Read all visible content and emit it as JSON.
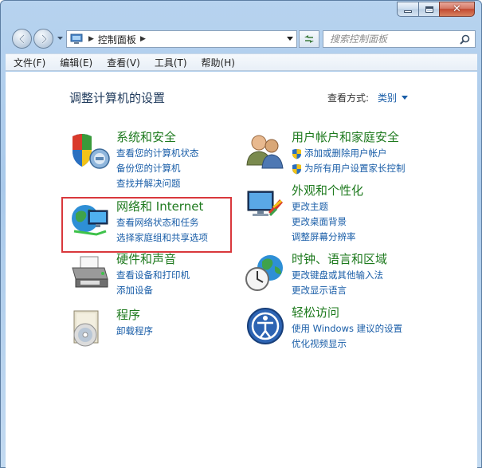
{
  "address": {
    "crumb": "控制面板",
    "search_placeholder": "搜索控制面板"
  },
  "menu": [
    "文件(F)",
    "编辑(E)",
    "查看(V)",
    "工具(T)",
    "帮助(H)"
  ],
  "content": {
    "title": "调整计算机的设置",
    "view_by_label": "查看方式:",
    "view_by_value": "类别"
  },
  "categories": {
    "system_security": {
      "title": "系统和安全",
      "icon": "shield-pc-icon",
      "links": [
        "查看您的计算机状态",
        "备份您的计算机",
        "查找并解决问题"
      ]
    },
    "network": {
      "title": "网络和 Internet",
      "icon": "network-globe-icon",
      "links": [
        "查看网络状态和任务",
        "选择家庭组和共享选项"
      ]
    },
    "hardware_sound": {
      "title": "硬件和声音",
      "icon": "printer-icon",
      "links": [
        "查看设备和打印机",
        "添加设备"
      ]
    },
    "programs": {
      "title": "程序",
      "icon": "programs-disc-icon",
      "links": [
        "卸载程序"
      ]
    },
    "user_accounts": {
      "title": "用户帐户和家庭安全",
      "icon": "users-icon",
      "links": [
        "添加或删除用户帐户",
        "为所有用户设置家长控制"
      ]
    },
    "appearance": {
      "title": "外观和个性化",
      "icon": "monitor-paint-icon",
      "links": [
        "更改主题",
        "更改桌面背景",
        "调整屏幕分辨率"
      ]
    },
    "clock_region": {
      "title": "时钟、语言和区域",
      "icon": "clock-globe-icon",
      "links": [
        "更改键盘或其他输入法",
        "更改显示语言"
      ]
    },
    "ease_access": {
      "title": "轻松访问",
      "icon": "ease-of-access-icon",
      "links": [
        "使用 Windows 建议的设置",
        "优化视频显示"
      ]
    }
  },
  "colors": {
    "category_title": "#1e7a1e",
    "link": "#1a5ea8",
    "highlight": "#d9383c"
  }
}
